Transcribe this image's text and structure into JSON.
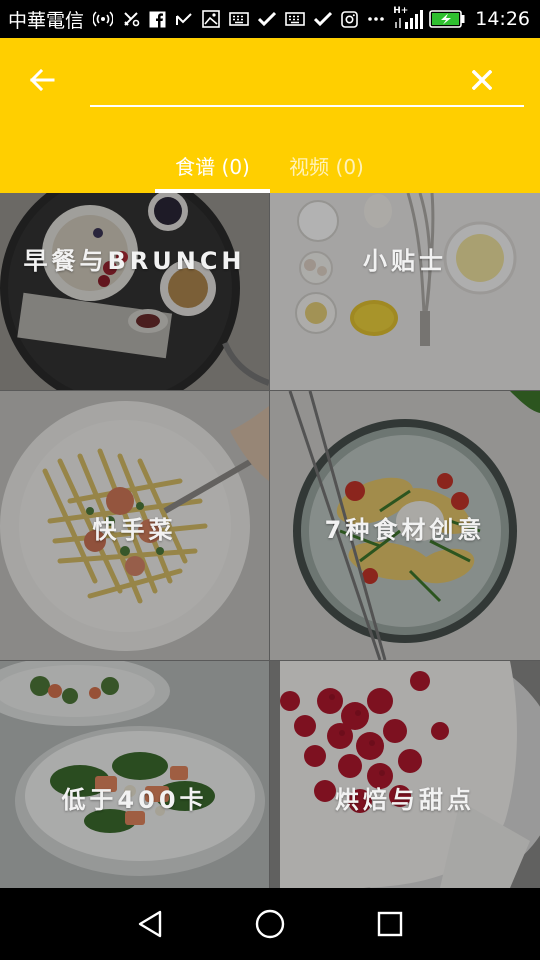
{
  "status_bar": {
    "carrier": "中華電信",
    "time": "14:26",
    "network": "H+",
    "icons": [
      "hotspot-icon",
      "usb-icon",
      "facebook-icon",
      "signal-app-icon",
      "image-icon",
      "keyboard-icon",
      "check-icon",
      "keyboard-icon",
      "check-icon",
      "instagram-icon",
      "more-icon",
      "signal-icon",
      "battery-charging-icon"
    ]
  },
  "app_bar": {
    "accent_color": "#FFCF00",
    "search": {
      "value": "",
      "placeholder": ""
    },
    "tabs": [
      {
        "label": "食谱 (0)",
        "selected": true
      },
      {
        "label": "视频 (0)",
        "selected": false
      }
    ]
  },
  "categories": [
    {
      "label": "早餐与BRUNCH"
    },
    {
      "label": "小贴士"
    },
    {
      "label": "快手菜"
    },
    {
      "label": "7种食材创意"
    },
    {
      "label": "低于400卡"
    },
    {
      "label": "烘焙与甜点"
    }
  ]
}
